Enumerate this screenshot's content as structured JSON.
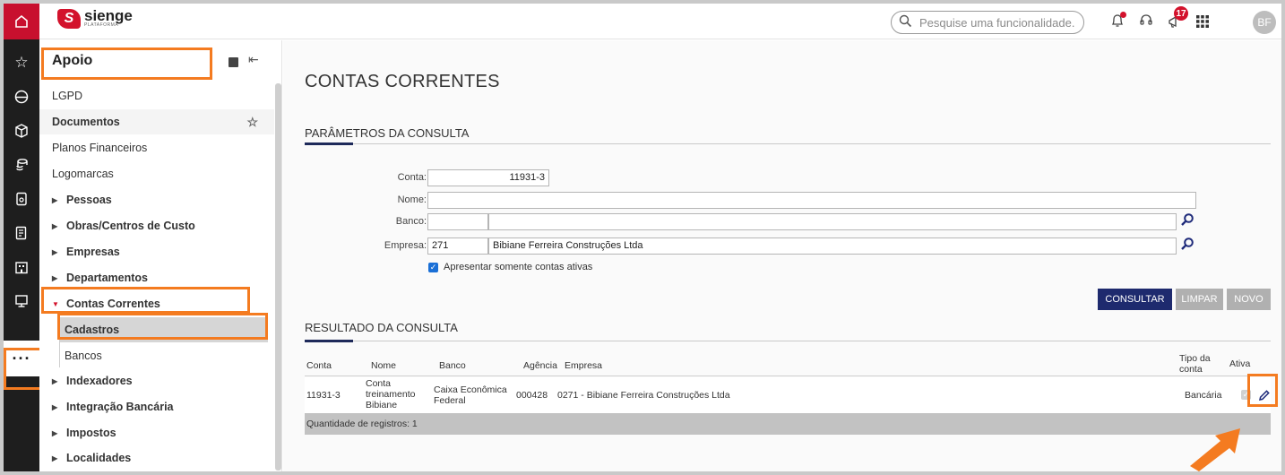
{
  "topbar": {
    "logo_mark": "S",
    "logo_name": "sienge",
    "logo_sub": "PLATAFORMA",
    "search_placeholder": "Pesquise uma funcionalidade.",
    "megaphone_badge": "17",
    "avatar_initials": "BF"
  },
  "rail": {
    "items": [
      "home-icon",
      "star-icon",
      "helmet-icon",
      "cube-icon",
      "coins-icon",
      "invoice-icon",
      "report-icon",
      "building-icon",
      "monitor-icon",
      "more-icon"
    ],
    "more_label": "···"
  },
  "sidebar": {
    "title": "Apoio",
    "items": [
      {
        "label": "LGPD",
        "type": "plain"
      },
      {
        "label": "Documentos",
        "type": "plain-bold"
      },
      {
        "label": "Planos Financeiros",
        "type": "plain"
      },
      {
        "label": "Logomarcas",
        "type": "plain"
      },
      {
        "label": "Pessoas",
        "type": "group"
      },
      {
        "label": "Obras/Centros de Custo",
        "type": "group"
      },
      {
        "label": "Empresas",
        "type": "group"
      },
      {
        "label": "Departamentos",
        "type": "group"
      },
      {
        "label": "Contas Correntes",
        "type": "group-open"
      },
      {
        "label": "Cadastros",
        "type": "sub-active"
      },
      {
        "label": "Bancos",
        "type": "sub"
      },
      {
        "label": "Indexadores",
        "type": "group"
      },
      {
        "label": "Integração Bancária",
        "type": "group"
      },
      {
        "label": "Impostos",
        "type": "group"
      },
      {
        "label": "Localidades",
        "type": "group"
      }
    ]
  },
  "main": {
    "page_title": "CONTAS CORRENTES",
    "params_title": "PARÂMETROS DA CONSULTA",
    "fields": {
      "conta_label": "Conta:",
      "conta_value": "11931-3",
      "nome_label": "Nome:",
      "nome_value": "",
      "banco_label": "Banco:",
      "banco_code": "",
      "banco_name": "",
      "empresa_label": "Empresa:",
      "empresa_code": "271",
      "empresa_name": "Bibiane Ferreira Construções Ltda"
    },
    "checkbox_label": "Apresentar somente contas ativas",
    "checkbox_checked": true,
    "buttons": {
      "consultar": "CONSULTAR",
      "limpar": "LIMPAR",
      "novo": "NOVO"
    },
    "result_title": "RESULTADO DA CONSULTA",
    "table": {
      "headers": {
        "conta": "Conta",
        "nome": "Nome",
        "banco": "Banco",
        "agencia": "Agência",
        "empresa": "Empresa",
        "tipo_1": "Tipo da",
        "tipo_2": "conta",
        "ativa": "Ativa"
      },
      "row": {
        "conta": "11931-3",
        "nome_1": "Conta",
        "nome_2": "treinamento",
        "nome_3": "Bibiane",
        "banco_1": "Caixa Econômica",
        "banco_2": "Federal",
        "agencia": "000428",
        "empresa": "0271 - Bibiane Ferreira Construções Ltda",
        "tipo": "Bancária",
        "ativa": true
      },
      "footer": "Quantidade de registros: 1"
    }
  },
  "colors": {
    "brand": "#d3122c",
    "primary_button": "#1e2a6e",
    "highlight": "#f47b20"
  }
}
